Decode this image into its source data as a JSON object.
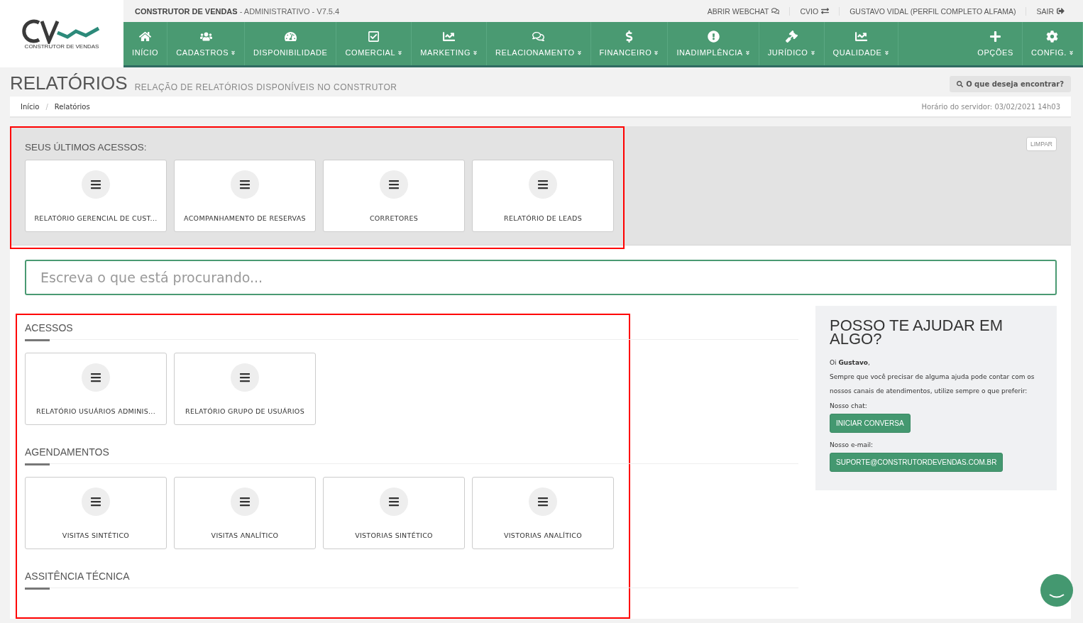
{
  "header": {
    "logo_text": "CONSTRUTOR DE VENDAS",
    "app_name": "CONSTRUTOR DE VENDAS",
    "app_suffix": " - ADMINISTRATIVO - V7.5.4",
    "top_links": [
      {
        "label": "ABRIR WEBCHAT",
        "kind": "chat"
      },
      {
        "label": "CVIO",
        "kind": "swap"
      },
      {
        "label": "GUSTAVO VIDAL (PERFIL COMPLETO ALFAMA)",
        "kind": "plain"
      },
      {
        "label": "SAIR",
        "kind": "exit"
      }
    ]
  },
  "nav": {
    "items": [
      {
        "label": "INÍCIO",
        "kind": "home",
        "dropdown": false
      },
      {
        "label": "CADASTROS",
        "kind": "users",
        "dropdown": true
      },
      {
        "label": "DISPONIBILIDADE",
        "kind": "gauge",
        "dropdown": false
      },
      {
        "label": "COMERCIAL",
        "kind": "check",
        "dropdown": true
      },
      {
        "label": "MARKETING",
        "kind": "chart",
        "dropdown": true
      },
      {
        "label": "RELACIONAMENTO",
        "kind": "chat",
        "dropdown": true
      },
      {
        "label": "FINANCEIRO",
        "kind": "dollar",
        "dropdown": true
      },
      {
        "label": "INADIMPLÊNCIA",
        "kind": "alert",
        "dropdown": true
      },
      {
        "label": "JURÍDICO",
        "kind": "gavel",
        "dropdown": true
      },
      {
        "label": "QUALIDADE",
        "kind": "chart",
        "dropdown": true
      }
    ],
    "right_items": [
      {
        "label": "OPÇÕES",
        "kind": "plus",
        "dropdown": false
      },
      {
        "label": "CONFIG.",
        "kind": "cog",
        "dropdown": true
      }
    ]
  },
  "page": {
    "title": "RELATÓRIOS",
    "subtitle": "RELAÇÃO DE RELATÓRIOS DISPONÍVEIS NO CONSTRUTOR",
    "search_button": "O que deseja encontrar?"
  },
  "breadcrumb": {
    "separator": "/",
    "items": [
      "Início",
      "Relatórios"
    ],
    "server_time": "Horário do servidor: 03/02/2021 14h03"
  },
  "recent": {
    "title": "SEUS ÚLTIMOS ACESSOS:",
    "highlighted": true,
    "clear_button": "LIMPAR",
    "cards": [
      "RELATÓRIO GERENCIAL DE CUST...",
      "ACOMPANHAMENTO DE RESERVAS",
      "CORRETORES",
      "RELATÓRIO DE LEADS"
    ]
  },
  "search": {
    "placeholder": "Escreva o que está procurando..."
  },
  "sections_highlighted": true,
  "sections": [
    {
      "title": "ACESSOS",
      "cards": [
        "RELATÓRIO USUÁRIOS ADMINIS...",
        "RELATÓRIO GRUPO DE USUÁRIOS"
      ]
    },
    {
      "title": "AGENDAMENTOS",
      "cards": [
        "VISITAS SINTÉTICO",
        "VISITAS ANALÍTICO",
        "VISTORIAS SINTÉTICO",
        "VISTORIAS ANALÍTICO"
      ]
    },
    {
      "title": "ASSITÊNCIA TÉCNICA"
    }
  ],
  "help": {
    "title": "POSSO TE AJUDAR EM ALGO?",
    "greeting": "Oi **Gustavo**,",
    "text": "Sempre que você precisar de alguma ajuda pode contar com os nossos canais de atendimentos, utilize sempre o que preferir:",
    "chat_label": "Nosso chat:",
    "chat_button": "INICIAR CONVERSA",
    "email_label": "Nosso e-mail:",
    "email_button": "SUPORTE@CONSTRUTORDEVENDAS.COM.BR"
  }
}
